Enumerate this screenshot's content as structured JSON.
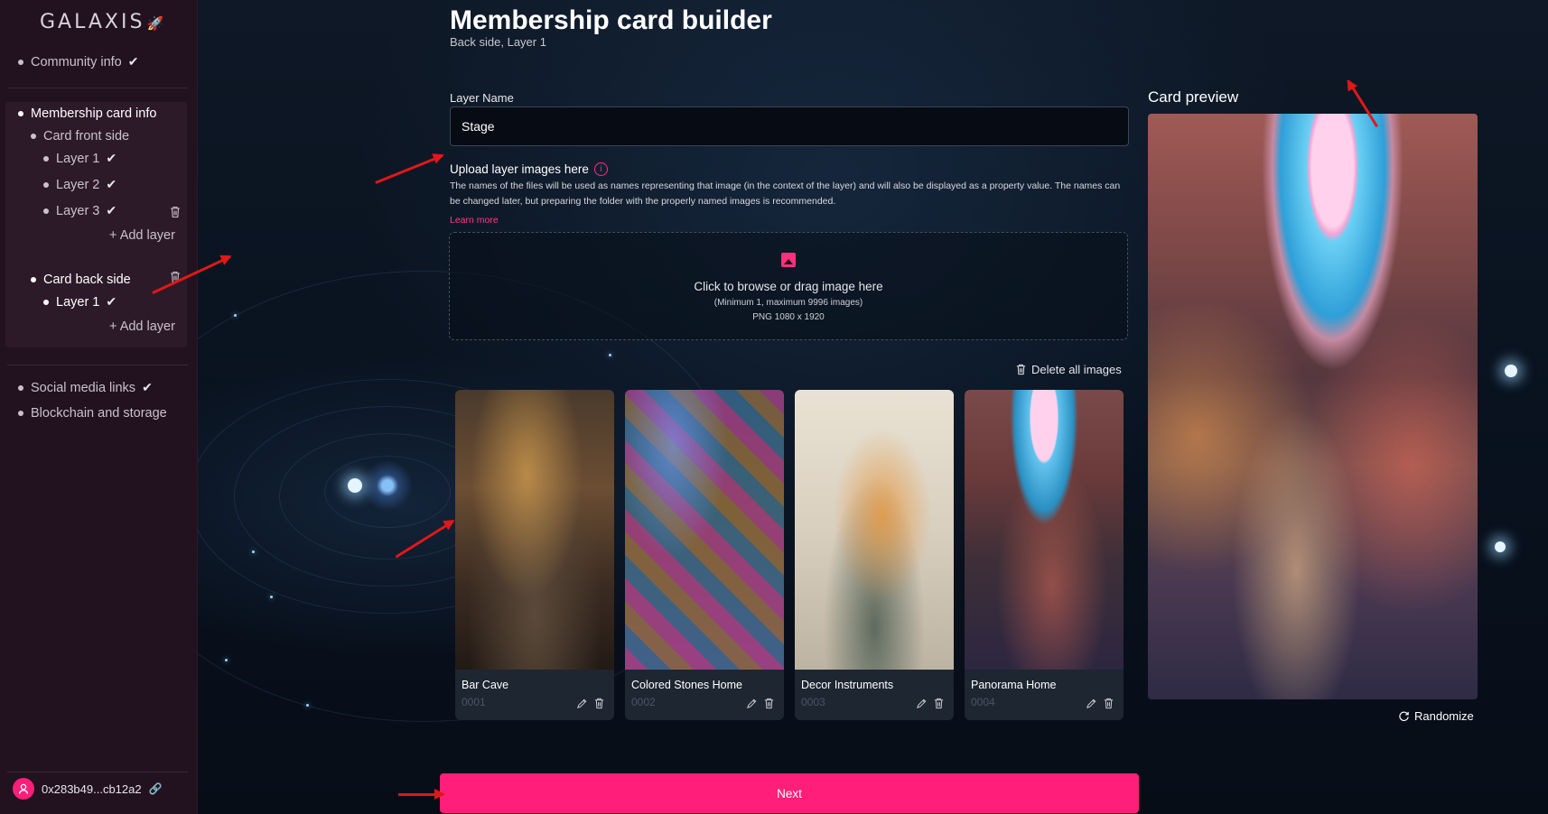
{
  "sidebar": {
    "logo": "GALAXIS",
    "community_info": "Community info",
    "membership_card_info": "Membership card info",
    "card_front_side": "Card front side",
    "front_layers": [
      "Layer 1",
      "Layer 2",
      "Layer 3"
    ],
    "add_layer": "+ Add layer",
    "card_back_side": "Card back side",
    "back_layers": [
      "Layer 1"
    ],
    "social_media_links": "Social media links",
    "blockchain_and_storage": "Blockchain and storage",
    "wallet_address": "0x283b49...cb12a2"
  },
  "header": {
    "title": "Membership card builder",
    "subtitle": "Back side, Layer 1"
  },
  "form": {
    "layer_name_label": "Layer Name",
    "layer_name_value": "Stage",
    "upload_label": "Upload layer images here",
    "description": "The names of the files will be used as names representing that image (in the context of the layer) and will also be displayed as a property value. The names can be changed later, but preparing the folder with the properly named images is recommended.",
    "learn_more": "Learn more",
    "dropzone_main": "Click to browse or drag image here",
    "dropzone_sub": "(Minimum 1, maximum 9996 images)",
    "dropzone_format": "PNG 1080 x 1920",
    "delete_all": "Delete all images"
  },
  "images": [
    {
      "name": "Bar Cave",
      "id": "0001"
    },
    {
      "name": "Colored Stones Home",
      "id": "0002"
    },
    {
      "name": "Decor Instruments",
      "id": "0003"
    },
    {
      "name": "Panorama Home",
      "id": "0004"
    }
  ],
  "preview": {
    "title": "Card preview",
    "randomize": "Randomize"
  },
  "next_button": "Next",
  "colors": {
    "accent": "#ff1f7a",
    "sidebar_bg": "#22121f",
    "annotation": "#e01818"
  }
}
